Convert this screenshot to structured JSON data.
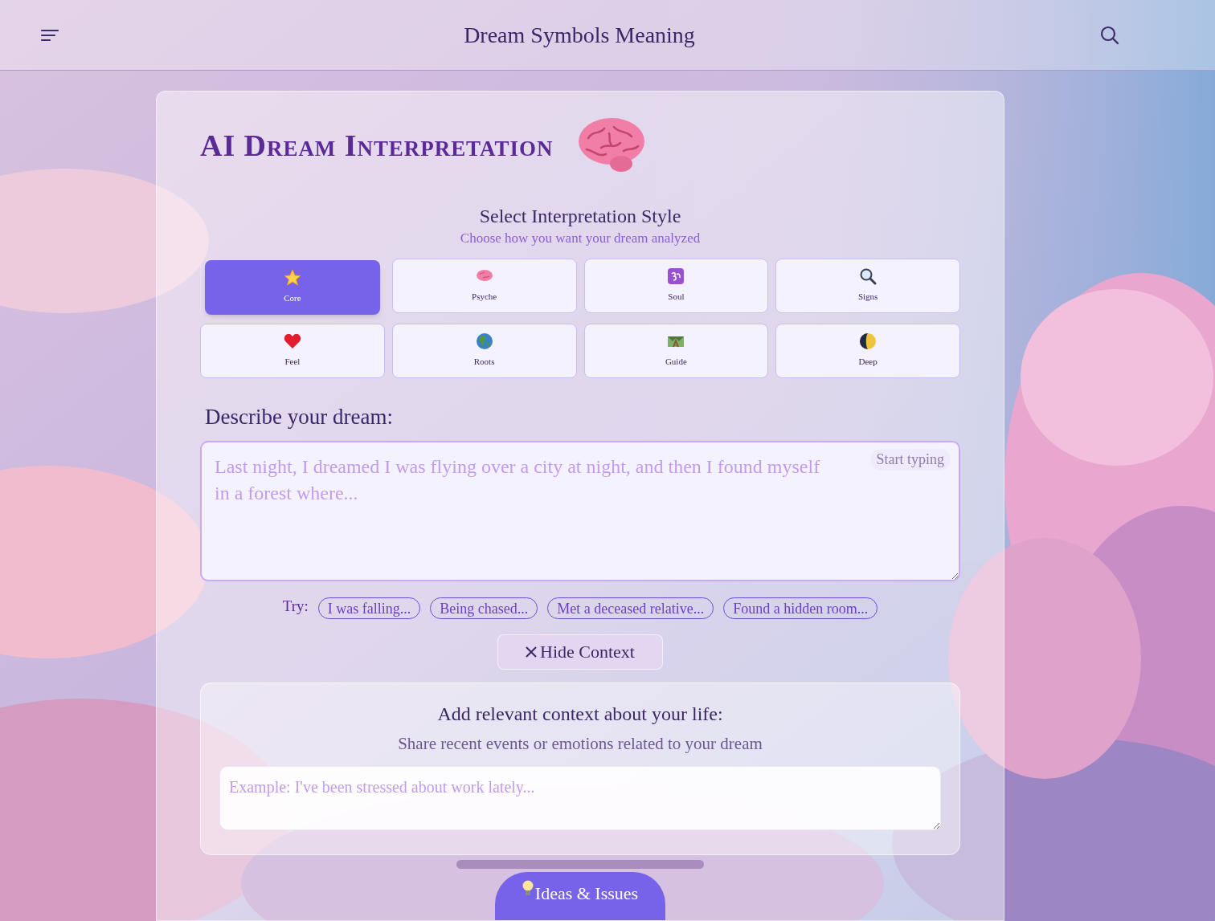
{
  "header": {
    "title": "Dream Symbols Meaning"
  },
  "card": {
    "title": "AI Dream Interpretation",
    "style_section": {
      "heading": "Select Interpretation Style",
      "subheading": "Choose how you want your dream analyzed"
    },
    "styles": [
      {
        "label": "Core",
        "selected": true
      },
      {
        "label": "Psyche",
        "selected": false
      },
      {
        "label": "Soul",
        "selected": false
      },
      {
        "label": "Signs",
        "selected": false
      },
      {
        "label": "Feel",
        "selected": false
      },
      {
        "label": "Roots",
        "selected": false
      },
      {
        "label": "Guide",
        "selected": false
      },
      {
        "label": "Deep",
        "selected": false
      }
    ],
    "dream_label": "Describe your dream:",
    "dream_field": {
      "placeholder": "Last night, I dreamed I was flying over a city at night, and then I found myself in a forest where...",
      "hint_badge": "Start typing"
    },
    "try_label": "Try:",
    "suggestions": [
      "I was falling...",
      "Being chased...",
      "Met a deceased relative...",
      "Found a hidden room..."
    ],
    "hide_context_button": "Hide Context",
    "context": {
      "heading": "Add relevant context about your life:",
      "subheading": "Share recent events or emotions related to your dream",
      "placeholder": "Example: I've been stressed about work lately..."
    }
  },
  "feedback_button": "Ideas & Issues"
}
